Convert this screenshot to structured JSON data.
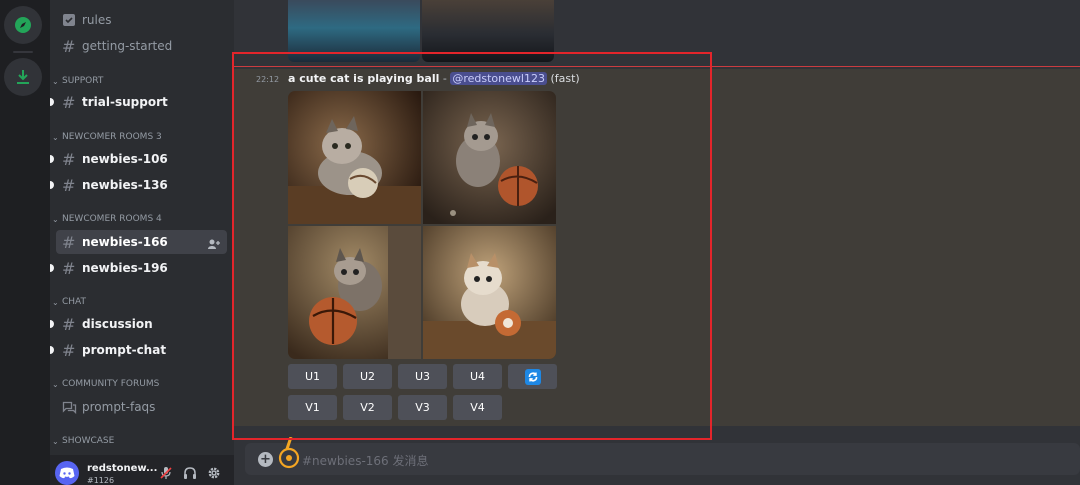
{
  "sidebar": {
    "channels": [
      {
        "label": "rules",
        "icon": "rules-checkbox-icon"
      },
      {
        "label": "getting-started",
        "icon": "hashtag-icon"
      }
    ],
    "categories": [
      {
        "label": "SUPPORT",
        "items": [
          {
            "label": "trial-support",
            "icon": "hashtag-icon",
            "unread": true
          }
        ]
      },
      {
        "label": "NEWCOMER ROOMS 3",
        "items": [
          {
            "label": "newbies-106",
            "icon": "threads-hashtag-icon",
            "unread": true
          },
          {
            "label": "newbies-136",
            "icon": "threads-hashtag-icon",
            "unread": true
          }
        ]
      },
      {
        "label": "NEWCOMER ROOMS 4",
        "items": [
          {
            "label": "newbies-166",
            "icon": "threads-hashtag-icon",
            "active": true
          },
          {
            "label": "newbies-196",
            "icon": "threads-hashtag-icon",
            "unread": true
          }
        ]
      },
      {
        "label": "CHAT",
        "items": [
          {
            "label": "discussion",
            "icon": "hashtag-icon",
            "unread": true
          },
          {
            "label": "prompt-chat",
            "icon": "threads-hashtag-icon",
            "unread": true
          }
        ]
      },
      {
        "label": "COMMUNITY FORUMS",
        "items": [
          {
            "label": "prompt-faqs",
            "icon": "forum-icon"
          }
        ]
      },
      {
        "label": "SHOWCASE",
        "items": []
      }
    ]
  },
  "user": {
    "name": "redstonew...",
    "tag": "#1126"
  },
  "message": {
    "time": "22:12",
    "prompt": "a cute cat is playing ball",
    "dash": " - ",
    "mention": "@redstonewl123",
    "speed": "(fast)",
    "upscale_buttons": [
      "U1",
      "U2",
      "U3",
      "U4"
    ],
    "variation_buttons": [
      "V1",
      "V2",
      "V3",
      "V4"
    ]
  },
  "composer": {
    "placeholder": "#newbies-166 发消息"
  },
  "colors": {
    "accent": "#5865f2",
    "highlight_border": "#e3252b",
    "new_divider": "#f23f42",
    "refresh_blue": "#1e88e5"
  }
}
